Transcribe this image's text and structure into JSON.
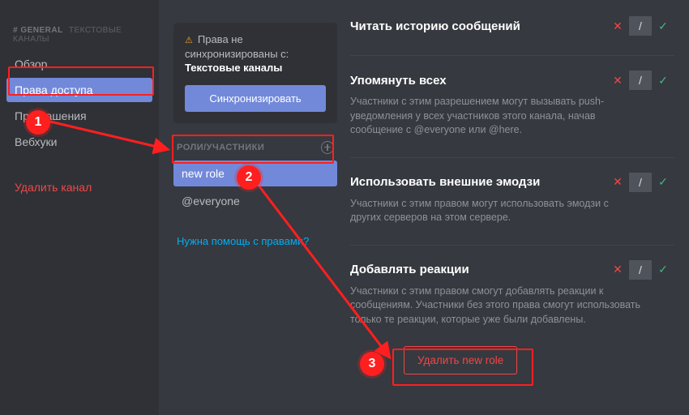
{
  "sidebar": {
    "header_main": "# GENERAL",
    "header_sub": "ТЕКСТОВЫЕ КАНАЛЫ",
    "items": [
      {
        "label": "Обзор"
      },
      {
        "label": "Права доступа"
      },
      {
        "label": "Приглашения"
      },
      {
        "label": "Вебхуки"
      }
    ],
    "delete_label": "Удалить канал"
  },
  "sync": {
    "line1": "Права не",
    "line2": "синхронизированы с:",
    "target": "Текстовые каналы",
    "button": "Синхронизировать"
  },
  "roles": {
    "header": "РОЛИ/УЧАСТНИКИ",
    "list": [
      {
        "label": "new role"
      },
      {
        "label": "@everyone"
      }
    ],
    "help": "Нужна помощь с правами?"
  },
  "permissions": [
    {
      "title": "Читать историю сообщений",
      "desc": ""
    },
    {
      "title": "Упомянуть всех",
      "desc": "Участники с этим разрешением могут вызывать push-уведомления у всех участников этого канала, начав сообщение с @everyone или @here."
    },
    {
      "title": "Использовать внешние эмодзи",
      "desc": "Участники с этим правом могут использовать эмодзи с других серверов на этом сервере."
    },
    {
      "title": "Добавлять реакции",
      "desc": "Участники с этим правом смогут добавлять реакции к сообщениям. Участники без этого права смогут использовать только те реакции, которые уже были добавлены."
    }
  ],
  "delete_role_button": "Удалить new role",
  "tri": {
    "deny": "✕",
    "pass": "/",
    "allow": "✓"
  },
  "overlay": {
    "n1": "1",
    "n2": "2",
    "n3": "3"
  }
}
